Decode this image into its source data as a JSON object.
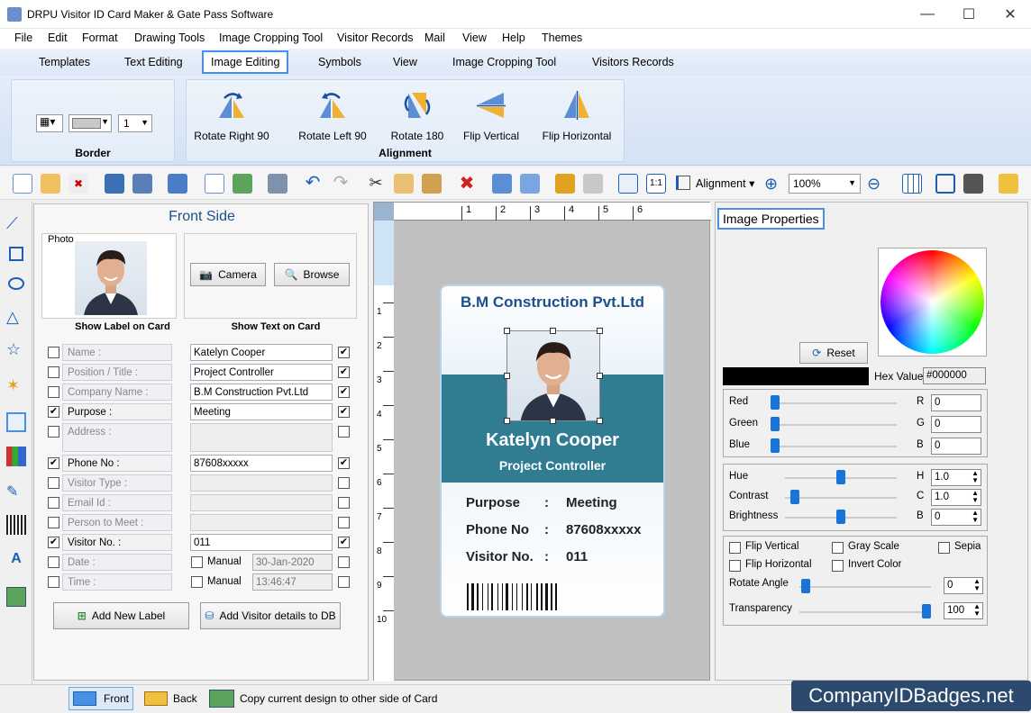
{
  "window": {
    "title": "DRPU Visitor ID Card Maker & Gate Pass Software"
  },
  "menu": [
    "File",
    "Edit",
    "Format",
    "Drawing Tools",
    "Image Cropping Tool",
    "Visitor Records",
    "Mail",
    "View",
    "Help",
    "Themes"
  ],
  "tabs": [
    "Templates",
    "Text Editing",
    "Image Editing",
    "Symbols",
    "View",
    "Image Cropping Tool",
    "Visitors Records"
  ],
  "ribbon": {
    "border_group": "Border",
    "border_value": "1",
    "alignment_group": "Alignment",
    "buttons": [
      "Rotate Right 90",
      "Rotate Left 90",
      "Rotate 180",
      "Flip Vertical",
      "Flip Horizontal"
    ]
  },
  "toolbar": {
    "alignment_label": "Alignment",
    "zoom": "100%"
  },
  "front": {
    "title": "Front Side",
    "photo_label": "Photo",
    "camera": "Camera",
    "browse": "Browse",
    "show_label": "Show Label on Card",
    "show_text": "Show Text on Card",
    "rows": [
      {
        "label": "Name :",
        "value": "Katelyn Cooper",
        "lchk": false,
        "rchk": true
      },
      {
        "label": "Position / Title :",
        "value": "Project Controller",
        "lchk": false,
        "rchk": true
      },
      {
        "label": "Company Name :",
        "value": "B.M Construction Pvt.Ltd",
        "lchk": false,
        "rchk": true
      },
      {
        "label": "Purpose     :",
        "value": "Meeting",
        "lchk": true,
        "rchk": true
      },
      {
        "label": "Address :",
        "value": "",
        "lchk": false,
        "rchk": false
      },
      {
        "label": "Phone No     :",
        "value": "87608xxxxx",
        "lchk": true,
        "rchk": true
      },
      {
        "label": "Visitor Type :",
        "value": "",
        "lchk": false,
        "rchk": false
      },
      {
        "label": "Email Id :",
        "value": "",
        "lchk": false,
        "rchk": false
      },
      {
        "label": "Person to Meet :",
        "value": "",
        "lchk": false,
        "rchk": false
      },
      {
        "label": "Visitor No.     :",
        "value": "011",
        "lchk": true,
        "rchk": true
      },
      {
        "label": "Date :",
        "value": "30-Jan-2020",
        "lchk": false,
        "rchk": false
      },
      {
        "label": "Time :",
        "value": "13:46:47",
        "lchk": false,
        "rchk": false
      }
    ],
    "manual": "Manual",
    "add_label": "Add New Label",
    "add_db": "Add Visitor details to DB"
  },
  "ruler": {
    "top": [
      "1",
      "2",
      "3",
      "4",
      "5",
      "6"
    ],
    "left": [
      "1",
      "2",
      "3",
      "4",
      "5",
      "6",
      "7",
      "8",
      "9",
      "10"
    ]
  },
  "card": {
    "company": "B.M Construction Pvt.Ltd",
    "name": "Katelyn Cooper",
    "title": "Project Controller",
    "rows": [
      [
        "Purpose",
        ":",
        "Meeting"
      ],
      [
        "Phone No",
        ":",
        "87608xxxxx"
      ],
      [
        "Visitor No.",
        ":",
        "011"
      ]
    ]
  },
  "props": {
    "title": "Image Properties",
    "reset": "Reset",
    "hex_label": "Hex Value",
    "hex": "#000000",
    "rgb": [
      {
        "name": "Red",
        "k": "R",
        "v": "0"
      },
      {
        "name": "Green",
        "k": "G",
        "v": "0"
      },
      {
        "name": "Blue",
        "k": "B",
        "v": "0"
      }
    ],
    "hcb": [
      {
        "name": "Hue",
        "k": "H",
        "v": "1.0",
        "pos": 0.5
      },
      {
        "name": "Contrast",
        "k": "C",
        "v": "1.0",
        "pos": 0.05
      },
      {
        "name": "Brightness",
        "k": "B",
        "v": "0",
        "pos": 0.5
      }
    ],
    "checks": [
      "Flip Vertical",
      "Gray Scale",
      "Sepia",
      "Flip Horizontal",
      "Invert Color"
    ],
    "rotate_label": "Rotate Angle",
    "rotate": "0",
    "transparency_label": "Transparency",
    "transparency": "100"
  },
  "status": {
    "front": "Front",
    "back": "Back",
    "copy": "Copy current design to other side of Card"
  },
  "brand": "CompanyIDBadges.net",
  "colors": {
    "accent": "#4a90e2",
    "card_band": "#2f7c93",
    "title_blue": "#1c4f8c"
  }
}
